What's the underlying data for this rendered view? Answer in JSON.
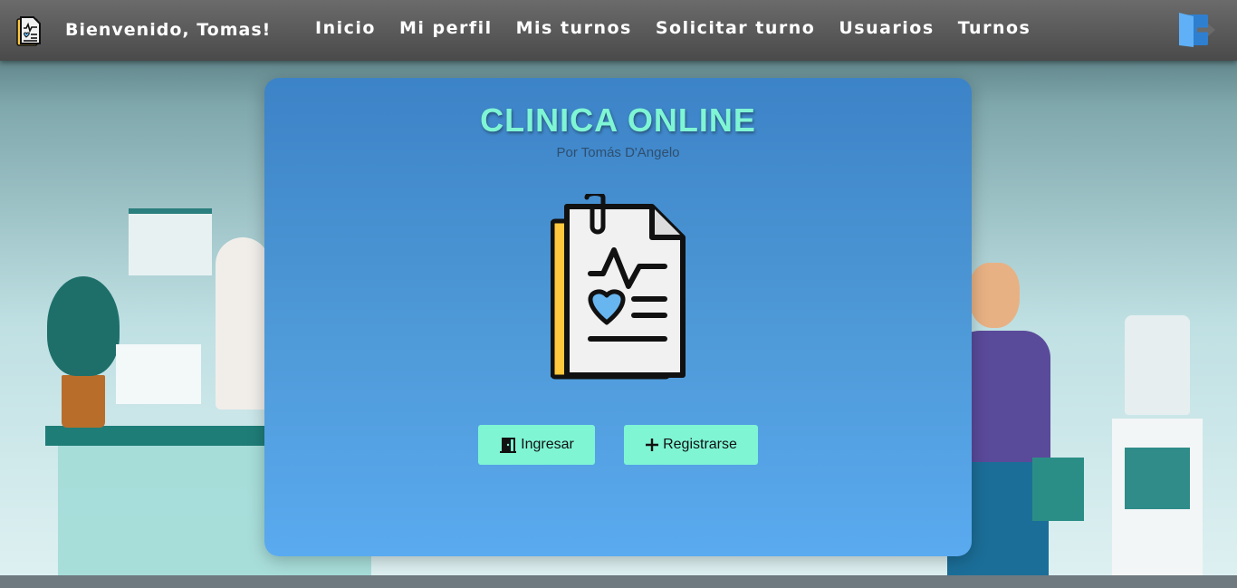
{
  "header": {
    "welcome": "Bienvenido, Tomas!",
    "nav": [
      "Inicio",
      "Mi perfil",
      "Mis turnos",
      "Solicitar turno",
      "Usuarios",
      "Turnos"
    ],
    "brand_icon": "medical-report-icon",
    "logout_icon": "logout-door-icon"
  },
  "card": {
    "title": "CLINICA ONLINE",
    "subtitle": "Por Tomás D'Angelo",
    "logo_icon": "medical-report-icon",
    "login_label": "Ingresar",
    "login_icon": "door-enter-icon",
    "register_label": "Registrarse",
    "register_icon": "plus-icon"
  },
  "colors": {
    "accent": "#7ff5d4",
    "card_bg": "#4f9ad8",
    "header_bg": "#555555",
    "logo_yellow": "#ffc83d",
    "logo_heart": "#67b6f0"
  }
}
